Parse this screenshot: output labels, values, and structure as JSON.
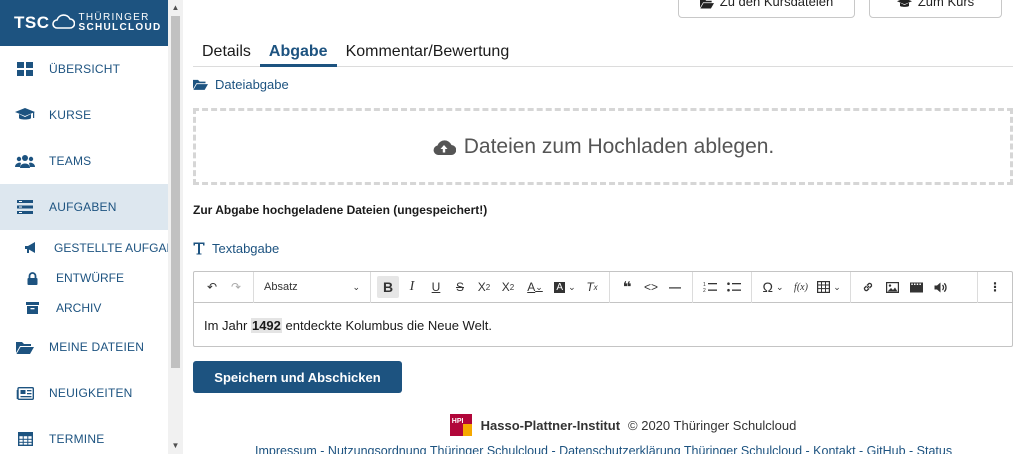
{
  "sidebar": {
    "logo": {
      "short": "TSC",
      "line1": "THÜRINGER",
      "line2": "SCHULCLOUD"
    },
    "items": [
      {
        "label": "ÜBERSICHT",
        "icon": "dashboard-icon"
      },
      {
        "label": "KURSE",
        "icon": "graduation-cap-icon"
      },
      {
        "label": "TEAMS",
        "icon": "users-icon"
      },
      {
        "label": "AUFGABEN",
        "icon": "tasks-icon",
        "active": true
      },
      {
        "label": "MEINE DATEIEN",
        "icon": "folder-open-icon"
      },
      {
        "label": "NEUIGKEITEN",
        "icon": "newspaper-icon"
      },
      {
        "label": "TERMINE",
        "icon": "calendar-icon"
      }
    ],
    "sub_items": [
      {
        "label": "GESTELLTE AUFGABEN",
        "icon": "bullhorn-icon"
      },
      {
        "label": "ENTWÜRFE",
        "icon": "lock-icon"
      },
      {
        "label": "ARCHIV",
        "icon": "archive-icon"
      }
    ]
  },
  "header": {
    "btn_course_files": "Zu den Kursdateien",
    "btn_to_course": "Zum Kurs"
  },
  "tabs": [
    {
      "label": "Details"
    },
    {
      "label": "Abgabe",
      "active": true
    },
    {
      "label": "Kommentar/Bewertung"
    }
  ],
  "file_submission": {
    "label": "Dateiabgabe",
    "dropzone_text": "Dateien zum Hochladen ablegen.",
    "uploaded_label": "Zur Abgabe hochgeladene Dateien (ungespeichert!)"
  },
  "text_submission": {
    "label": "Textabgabe",
    "heading_select": "Absatz",
    "content_before": "Im Jahr ",
    "content_highlight": "1492",
    "content_after": " entdeckte Kolumbus die Neue Welt."
  },
  "submit_label": "Speichern und Abschicken",
  "footer": {
    "hpi_badge": "HPI",
    "hpi_name": "Hasso-Plattner-Institut",
    "copyright": "© 2020 Thüringer Schulcloud",
    "links": "Impressum - Nutzungsordnung Thüringer Schulcloud - Datenschutzerklärung Thüringer Schulcloud - Kontakt - GitHub - Status"
  },
  "colors": {
    "brand": "#1d5380",
    "active_nav_bg": "#dde7ef",
    "hpi_red": "#b1063a",
    "hpi_yellow": "#f6a800"
  }
}
